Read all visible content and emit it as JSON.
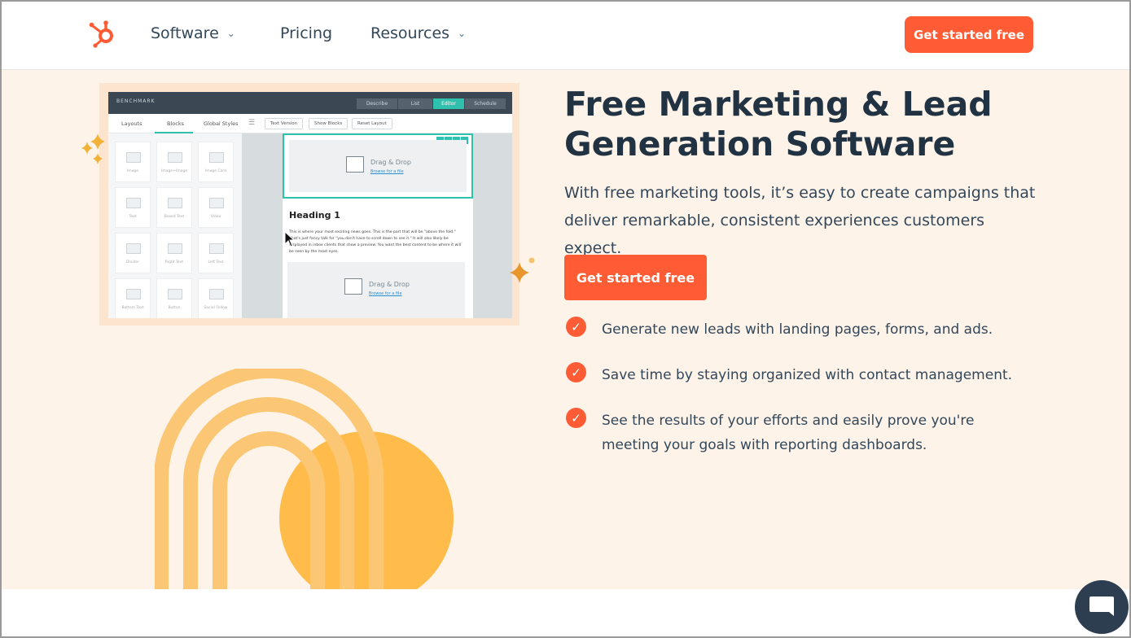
{
  "nav": {
    "logo_icon": "hubspot-sprocket-icon",
    "items": [
      {
        "label": "Software",
        "has_dropdown": true
      },
      {
        "label": "Pricing",
        "has_dropdown": false
      },
      {
        "label": "Resources",
        "has_dropdown": true
      }
    ],
    "cta_label": "Get started free"
  },
  "hero": {
    "title": "Free Marketing & Lead Generation Software",
    "subtitle": "With free marketing tools, it’s easy to create campaigns that deliver remarkable, consistent experiences customers expect.",
    "cta_label": "Get started free",
    "bullets": [
      "Generate new leads with landing pages, forms, and ads.",
      "Save time by staying organized with contact management.",
      "See the results of your efforts and easily prove you're meeting your goals with reporting dashboards."
    ]
  },
  "screenshot": {
    "brand": "BENCHMARK",
    "steps": [
      "Describe",
      "List",
      "Editor",
      "Schedule"
    ],
    "active_step": "Editor",
    "tabs": [
      "Layouts",
      "Blocks",
      "Global Styles"
    ],
    "toolbar": [
      "Text Version",
      "Show Blocks",
      "Reset Layout"
    ],
    "blocks": [
      "Image",
      "Image+Image",
      "Image Card",
      "Text",
      "Boxed Text",
      "Video",
      "Divider",
      "Right Text",
      "Left Text",
      "Bottom Text",
      "Button",
      "Social Follow"
    ],
    "drag_drop_title": "Drag & Drop",
    "drag_drop_link": "Browse for a file",
    "heading": "Heading 1",
    "body": "This is where your most exciting news goes. This is the part that will be \"above the fold.\" That's just fancy talk for \"you don't have to scroll down to see it.\" It will also likely be displayed in inbox clients that show a preview. You want the best content to be where it will be seen by the most eyes."
  },
  "colors": {
    "accent": "#ff5c35",
    "hero_bg": "#fdf3e8",
    "heading": "#213343",
    "arch": "#fcc774",
    "sun": "#ffbc4b"
  },
  "chat": {
    "icon": "chat-bubble-icon"
  }
}
